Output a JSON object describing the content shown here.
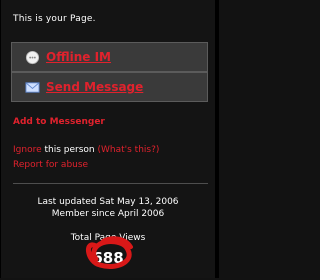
{
  "profile": {
    "header": "This is your Page.",
    "actions": [
      {
        "label": "Offline IM",
        "icon": "chat-bubble-icon"
      },
      {
        "label": "Send Message",
        "icon": "envelope-icon"
      }
    ],
    "add_link": "Add to Messenger",
    "ignore": {
      "link": "Ignore",
      "text": " this person ",
      "help": "(What's this?)"
    },
    "report": "Report for abuse",
    "last_updated": "Last updated Sat May 13, 2006",
    "member_since": "Member since April 2006",
    "views_label": "Total Page Views",
    "views_count": "688"
  },
  "colors": {
    "background": "#141414",
    "link_red": "#e0222d",
    "box_fill": "#3a3a3a",
    "annotation_circle": "#d81818"
  }
}
